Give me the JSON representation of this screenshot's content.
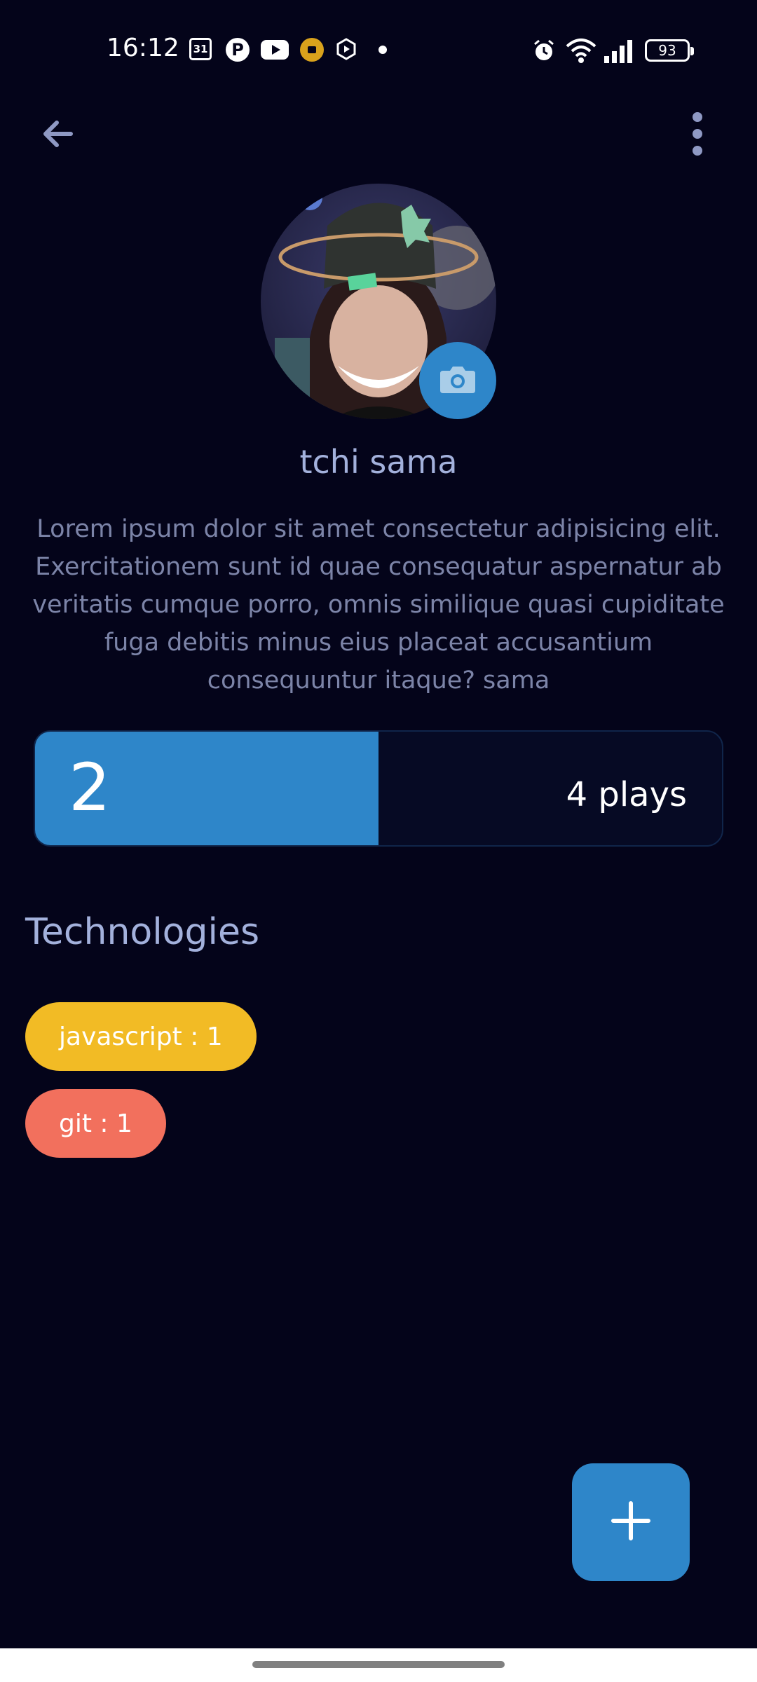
{
  "status_bar": {
    "time": "16:12",
    "calendar_day": "31",
    "battery": "93",
    "icons": [
      "calendar-icon",
      "pinterest-icon",
      "youtube-icon",
      "app-notification-icon",
      "hexagon-icon",
      "dot-icon",
      "alarm-icon",
      "wifi-icon",
      "signal-icon",
      "battery-icon"
    ]
  },
  "app_bar": {
    "back_icon": "arrow-left-icon",
    "more_icon": "more-vertical-icon"
  },
  "profile": {
    "name": "tchi sama",
    "bio": "Lorem ipsum dolor sit amet consectetur adipisicing elit. Exercitationem sunt id quae consequatur aspernatur ab veritatis cumque porro, omnis similique quasi cupiditate fuga debitis minus eius placeat accusantium consequuntur itaque? sama",
    "avatar_icon": "avatar-image",
    "camera_icon": "camera-icon"
  },
  "stats": {
    "value": "2",
    "label": "4 plays",
    "progress": 0.5
  },
  "technologies": {
    "title": "Technologies",
    "chips": [
      {
        "label": "javascript : 1",
        "color": "#f2bb25"
      },
      {
        "label": "git : 1",
        "color": "#f2705d"
      }
    ]
  },
  "fab": {
    "icon": "plus-icon"
  },
  "colors": {
    "background": "#04041a",
    "accent": "#2e86c9"
  }
}
